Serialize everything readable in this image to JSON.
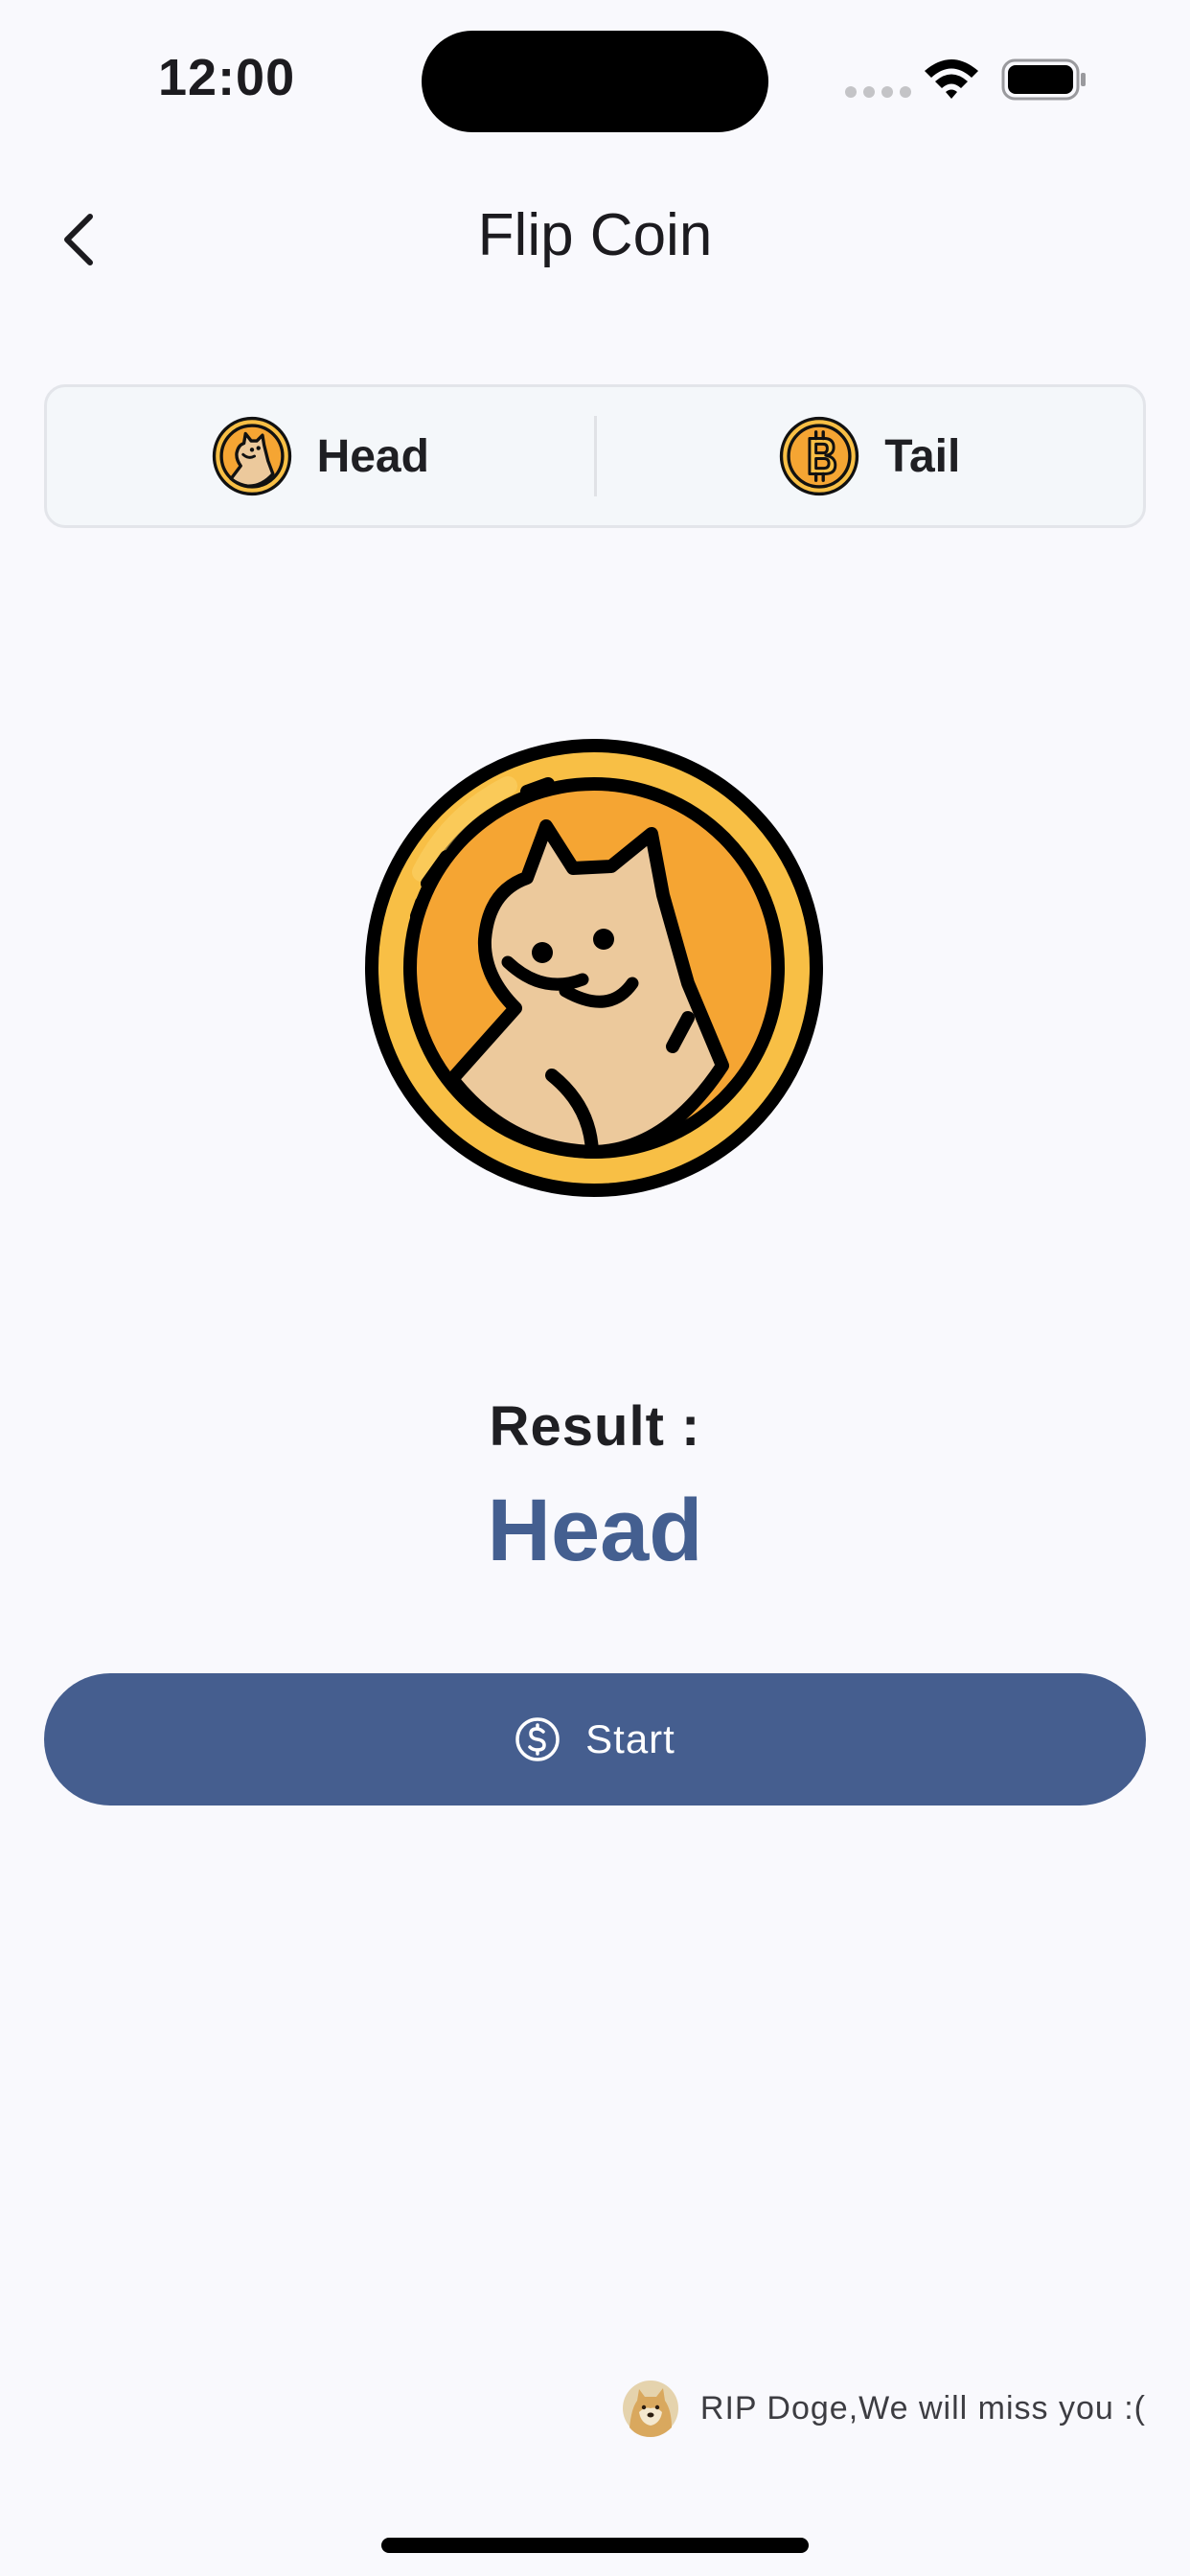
{
  "status_bar": {
    "time": "12:00"
  },
  "header": {
    "title": "Flip Coin"
  },
  "segmented": {
    "options": [
      {
        "label": "Head",
        "icon": "doge-coin-icon"
      },
      {
        "label": "Tail",
        "icon": "bitcoin-icon"
      }
    ]
  },
  "result": {
    "label": "Result :",
    "value": "Head"
  },
  "actions": {
    "start_label": "Start"
  },
  "footer": {
    "text": "RIP Doge,We will miss you :("
  },
  "colors": {
    "accent": "#455e8f",
    "result_text": "#445f90",
    "coin_gold": "#f5a533",
    "coin_rim": "#f8bf45",
    "doge_fur": "#ecc99c",
    "background": "#f9f9fd"
  }
}
